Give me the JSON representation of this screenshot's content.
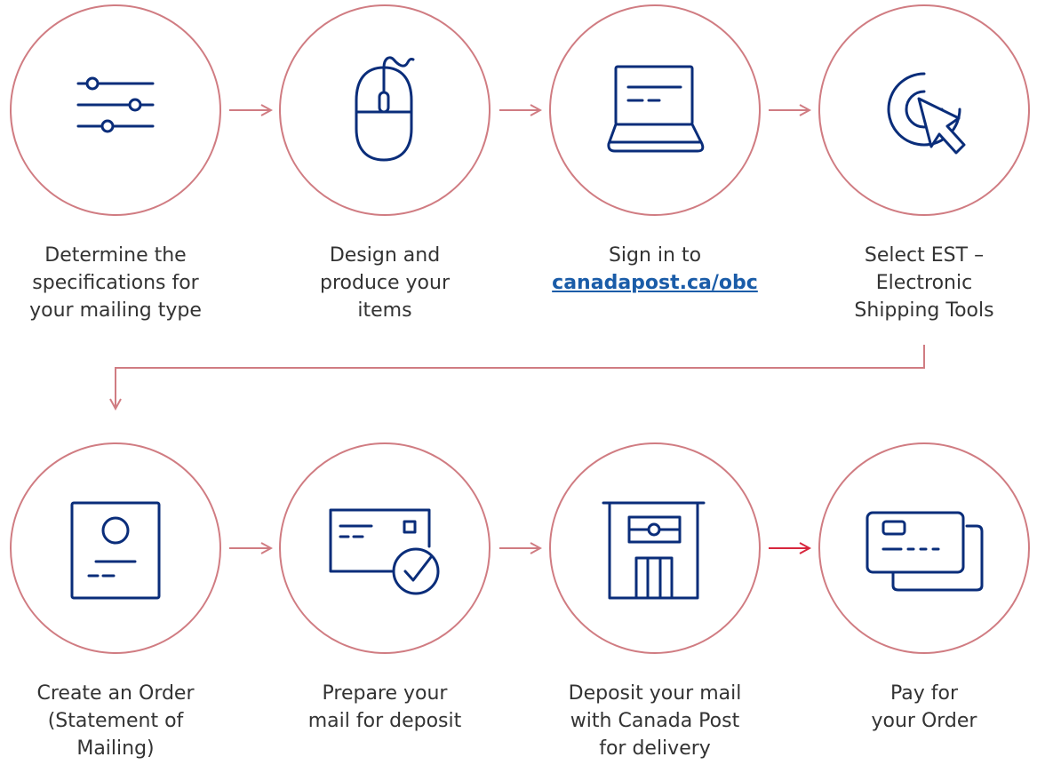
{
  "colors": {
    "ring": "#d07c82",
    "connector": "#d07c82",
    "connector_highlight": "#d7263d",
    "icon": "#0a2d7a",
    "text": "#333333",
    "link": "#1a5ca8"
  },
  "steps": [
    {
      "icon": "sliders-icon",
      "lines": [
        "Determine the",
        "specifications for",
        "your mailing type"
      ]
    },
    {
      "icon": "mouse-icon",
      "lines": [
        "Design and",
        "produce your",
        "items"
      ]
    },
    {
      "icon": "laptop-icon",
      "lines": [
        "Sign in to"
      ],
      "link": "canadapost.ca/obc"
    },
    {
      "icon": "click-cursor-icon",
      "lines": [
        "Select EST –",
        "Electronic",
        "Shipping Tools"
      ]
    },
    {
      "icon": "order-document-icon",
      "lines": [
        "Create an Order",
        "(Statement of",
        "Mailing)"
      ]
    },
    {
      "icon": "envelope-check-icon",
      "lines": [
        "Prepare your",
        "mail for deposit"
      ]
    },
    {
      "icon": "post-office-icon",
      "lines": [
        "Deposit your mail",
        "with Canada Post",
        "for delivery"
      ]
    },
    {
      "icon": "credit-cards-icon",
      "lines": [
        "Pay for",
        "your Order"
      ]
    }
  ]
}
